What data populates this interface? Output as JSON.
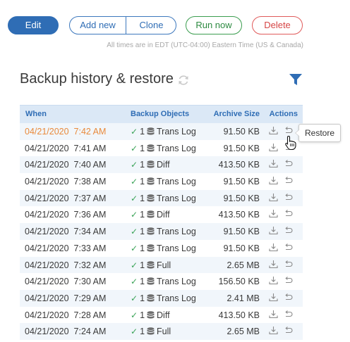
{
  "toolbar": {
    "edit_label": "Edit",
    "add_new_label": "Add new",
    "clone_label": "Clone",
    "run_now_label": "Run now",
    "delete_label": "Delete",
    "timezone_note": "All times are in EDT (UTC-04:00) Eastern Time (US & Canada)"
  },
  "section": {
    "title": "Backup history & restore",
    "refresh_icon": "refresh-icon",
    "filter_icon": "filter-icon"
  },
  "table": {
    "headers": {
      "when": "When",
      "backup_objects": "Backup Objects",
      "archive_size": "Archive Size",
      "actions": "Actions"
    },
    "rows": [
      {
        "date": "04/21/2020",
        "time": "7:42 AM",
        "count": "1",
        "type": "Trans Log",
        "size": "91.50 KB",
        "highlight": true
      },
      {
        "date": "04/21/2020",
        "time": "7:41 AM",
        "count": "1",
        "type": "Trans Log",
        "size": "91.50 KB"
      },
      {
        "date": "04/21/2020",
        "time": "7:40 AM",
        "count": "1",
        "type": "Diff",
        "size": "413.50 KB"
      },
      {
        "date": "04/21/2020",
        "time": "7:38 AM",
        "count": "1",
        "type": "Trans Log",
        "size": "91.50 KB"
      },
      {
        "date": "04/21/2020",
        "time": "7:37 AM",
        "count": "1",
        "type": "Trans Log",
        "size": "91.50 KB"
      },
      {
        "date": "04/21/2020",
        "time": "7:36 AM",
        "count": "1",
        "type": "Diff",
        "size": "413.50 KB"
      },
      {
        "date": "04/21/2020",
        "time": "7:34 AM",
        "count": "1",
        "type": "Trans Log",
        "size": "91.50 KB"
      },
      {
        "date": "04/21/2020",
        "time": "7:33 AM",
        "count": "1",
        "type": "Trans Log",
        "size": "91.50 KB"
      },
      {
        "date": "04/21/2020",
        "time": "7:32 AM",
        "count": "1",
        "type": "Full",
        "size": "2.65 MB"
      },
      {
        "date": "04/21/2020",
        "time": "7:30 AM",
        "count": "1",
        "type": "Trans Log",
        "size": "156.50 KB"
      },
      {
        "date": "04/21/2020",
        "time": "7:29 AM",
        "count": "1",
        "type": "Trans Log",
        "size": "2.41 MB"
      },
      {
        "date": "04/21/2020",
        "time": "7:28 AM",
        "count": "1",
        "type": "Diff",
        "size": "413.50 KB"
      },
      {
        "date": "04/21/2020",
        "time": "7:24 AM",
        "count": "1",
        "type": "Full",
        "size": "2.65 MB"
      }
    ]
  },
  "tooltip": {
    "text": "Restore"
  },
  "colors": {
    "primary": "#2f6db5",
    "success": "#3b9d4f",
    "danger": "#e05b5b",
    "highlight_text": "#e98a3b",
    "header_bg": "#dbe8f6",
    "stripe_bg": "#f1f6fb"
  }
}
